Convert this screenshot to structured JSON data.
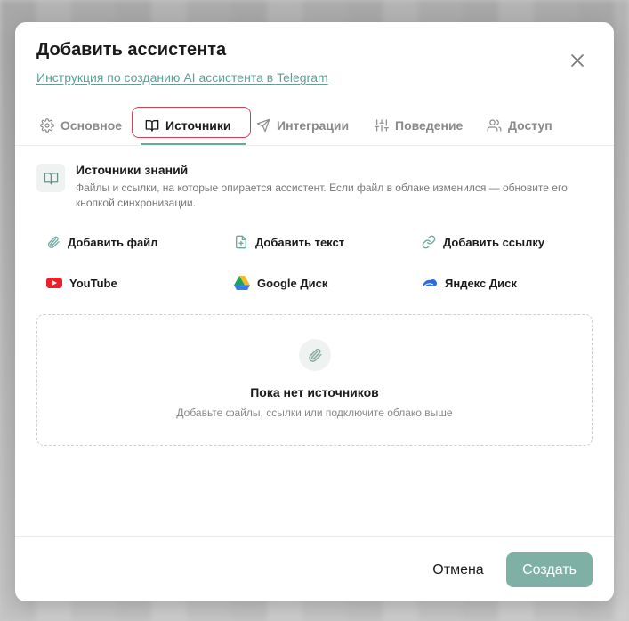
{
  "dialog": {
    "title": "Добавить ассистента",
    "guide_link": "Инструкция по созданию AI ассистента в Telegram"
  },
  "tabs": [
    {
      "label": "Основное",
      "icon": "gear-icon"
    },
    {
      "label": "Источники",
      "icon": "book-icon",
      "active": true
    },
    {
      "label": "Интеграции",
      "icon": "send-icon"
    },
    {
      "label": "Поведение",
      "icon": "sliders-icon"
    },
    {
      "label": "Доступ",
      "icon": "users-icon"
    }
  ],
  "section": {
    "title": "Источники знаний",
    "description": "Файлы и ссылки, на которые опирается ассистент. Если файл в облаке изменился — обновите его кнопкой синхронизации."
  },
  "actions": [
    {
      "label": "Добавить файл",
      "icon": "paperclip-icon"
    },
    {
      "label": "Добавить текст",
      "icon": "file-plus-icon"
    },
    {
      "label": "Добавить ссылку",
      "icon": "link-icon"
    },
    {
      "label": "YouTube",
      "icon": "youtube-icon",
      "color": "#e8202a"
    },
    {
      "label": "Google Диск",
      "icon": "google-drive-icon"
    },
    {
      "label": "Яндекс Диск",
      "icon": "yandex-disk-icon",
      "color": "#2f6bd8"
    }
  ],
  "empty_state": {
    "title": "Пока нет источников",
    "subtitle": "Добавьте файлы, ссылки или подключите облако выше"
  },
  "footer": {
    "cancel_label": "Отмена",
    "create_label": "Создать"
  },
  "colors": {
    "accent": "#6da89e",
    "primary_button": "#7fb0a5",
    "active_tab_outline": "#d6404e",
    "link": "#5f9f95"
  }
}
